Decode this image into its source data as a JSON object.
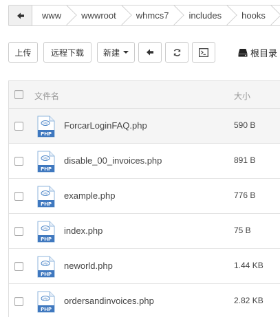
{
  "breadcrumb": {
    "segments": [
      "www",
      "wwwroot",
      "whmcs7",
      "includes",
      "hooks"
    ]
  },
  "toolbar": {
    "upload_label": "上传",
    "remote_download_label": "远程下载",
    "new_label": "新建",
    "root_label": "根目录"
  },
  "table": {
    "col_name": "文件名",
    "col_size": "大小",
    "icon_label": "PHP",
    "files": [
      {
        "name": "ForcarLoginFAQ.php",
        "size": "590 B"
      },
      {
        "name": "disable_00_invoices.php",
        "size": "891 B"
      },
      {
        "name": "example.php",
        "size": "776 B"
      },
      {
        "name": "index.php",
        "size": "75 B"
      },
      {
        "name": "neworld.php",
        "size": "1.44 KB"
      },
      {
        "name": "ordersandinvoices.php",
        "size": "2.82 KB"
      }
    ]
  }
}
